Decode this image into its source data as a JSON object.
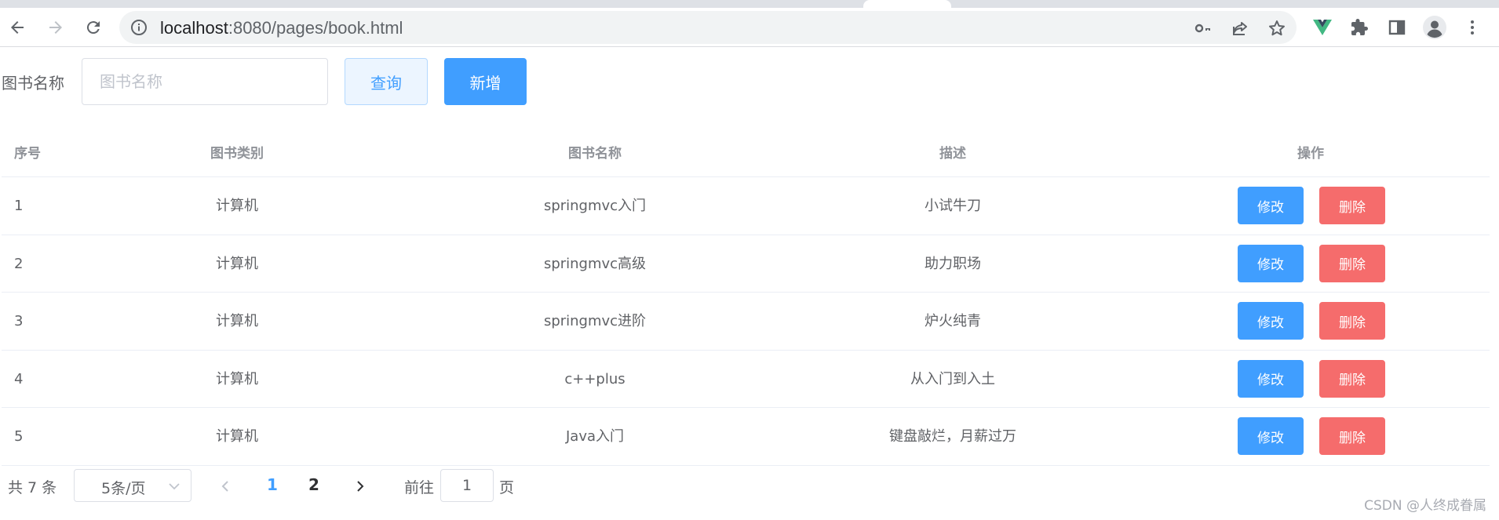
{
  "browser": {
    "url_host": "localhost",
    "url_rest": ":8080/pages/book.html",
    "icons": {
      "back": "back-arrow-icon",
      "forward": "forward-arrow-icon",
      "reload": "reload-icon",
      "info": "info-icon",
      "key": "key-icon",
      "share": "share-icon",
      "star": "star-icon",
      "vue": "vue-devtools-icon",
      "extensions": "puzzle-icon",
      "sidepanel": "side-panel-icon",
      "profile": "profile-icon",
      "menu": "more-vert-icon"
    }
  },
  "search": {
    "label": "图书名称",
    "placeholder": "图书名称",
    "value": "",
    "query_button": "查询",
    "add_button": "新增"
  },
  "table": {
    "headers": [
      "序号",
      "图书类别",
      "图书名称",
      "描述",
      "操作"
    ],
    "rows": [
      {
        "index": "1",
        "category": "计算机",
        "name": "springmvc入门",
        "description": "小试牛刀"
      },
      {
        "index": "2",
        "category": "计算机",
        "name": "springmvc高级",
        "description": "助力职场"
      },
      {
        "index": "3",
        "category": "计算机",
        "name": "springmvc进阶",
        "description": "炉火纯青"
      },
      {
        "index": "4",
        "category": "计算机",
        "name": "c++plus",
        "description": "从入门到入土"
      },
      {
        "index": "5",
        "category": "计算机",
        "name": "Java入门",
        "description": "键盘敲烂，月薪过万"
      }
    ],
    "edit_label": "修改",
    "delete_label": "删除"
  },
  "pagination": {
    "total": "共 7 条",
    "page_size": "5条/页",
    "pages": [
      "1",
      "2"
    ],
    "current_page": "1",
    "goto_prefix": "前往",
    "goto_value": "1",
    "goto_suffix": "页"
  },
  "watermark": "CSDN @人终成眷属",
  "colors": {
    "primary": "#409eff",
    "danger": "#f56c6c",
    "text": "#606266",
    "header_text": "#909399"
  }
}
